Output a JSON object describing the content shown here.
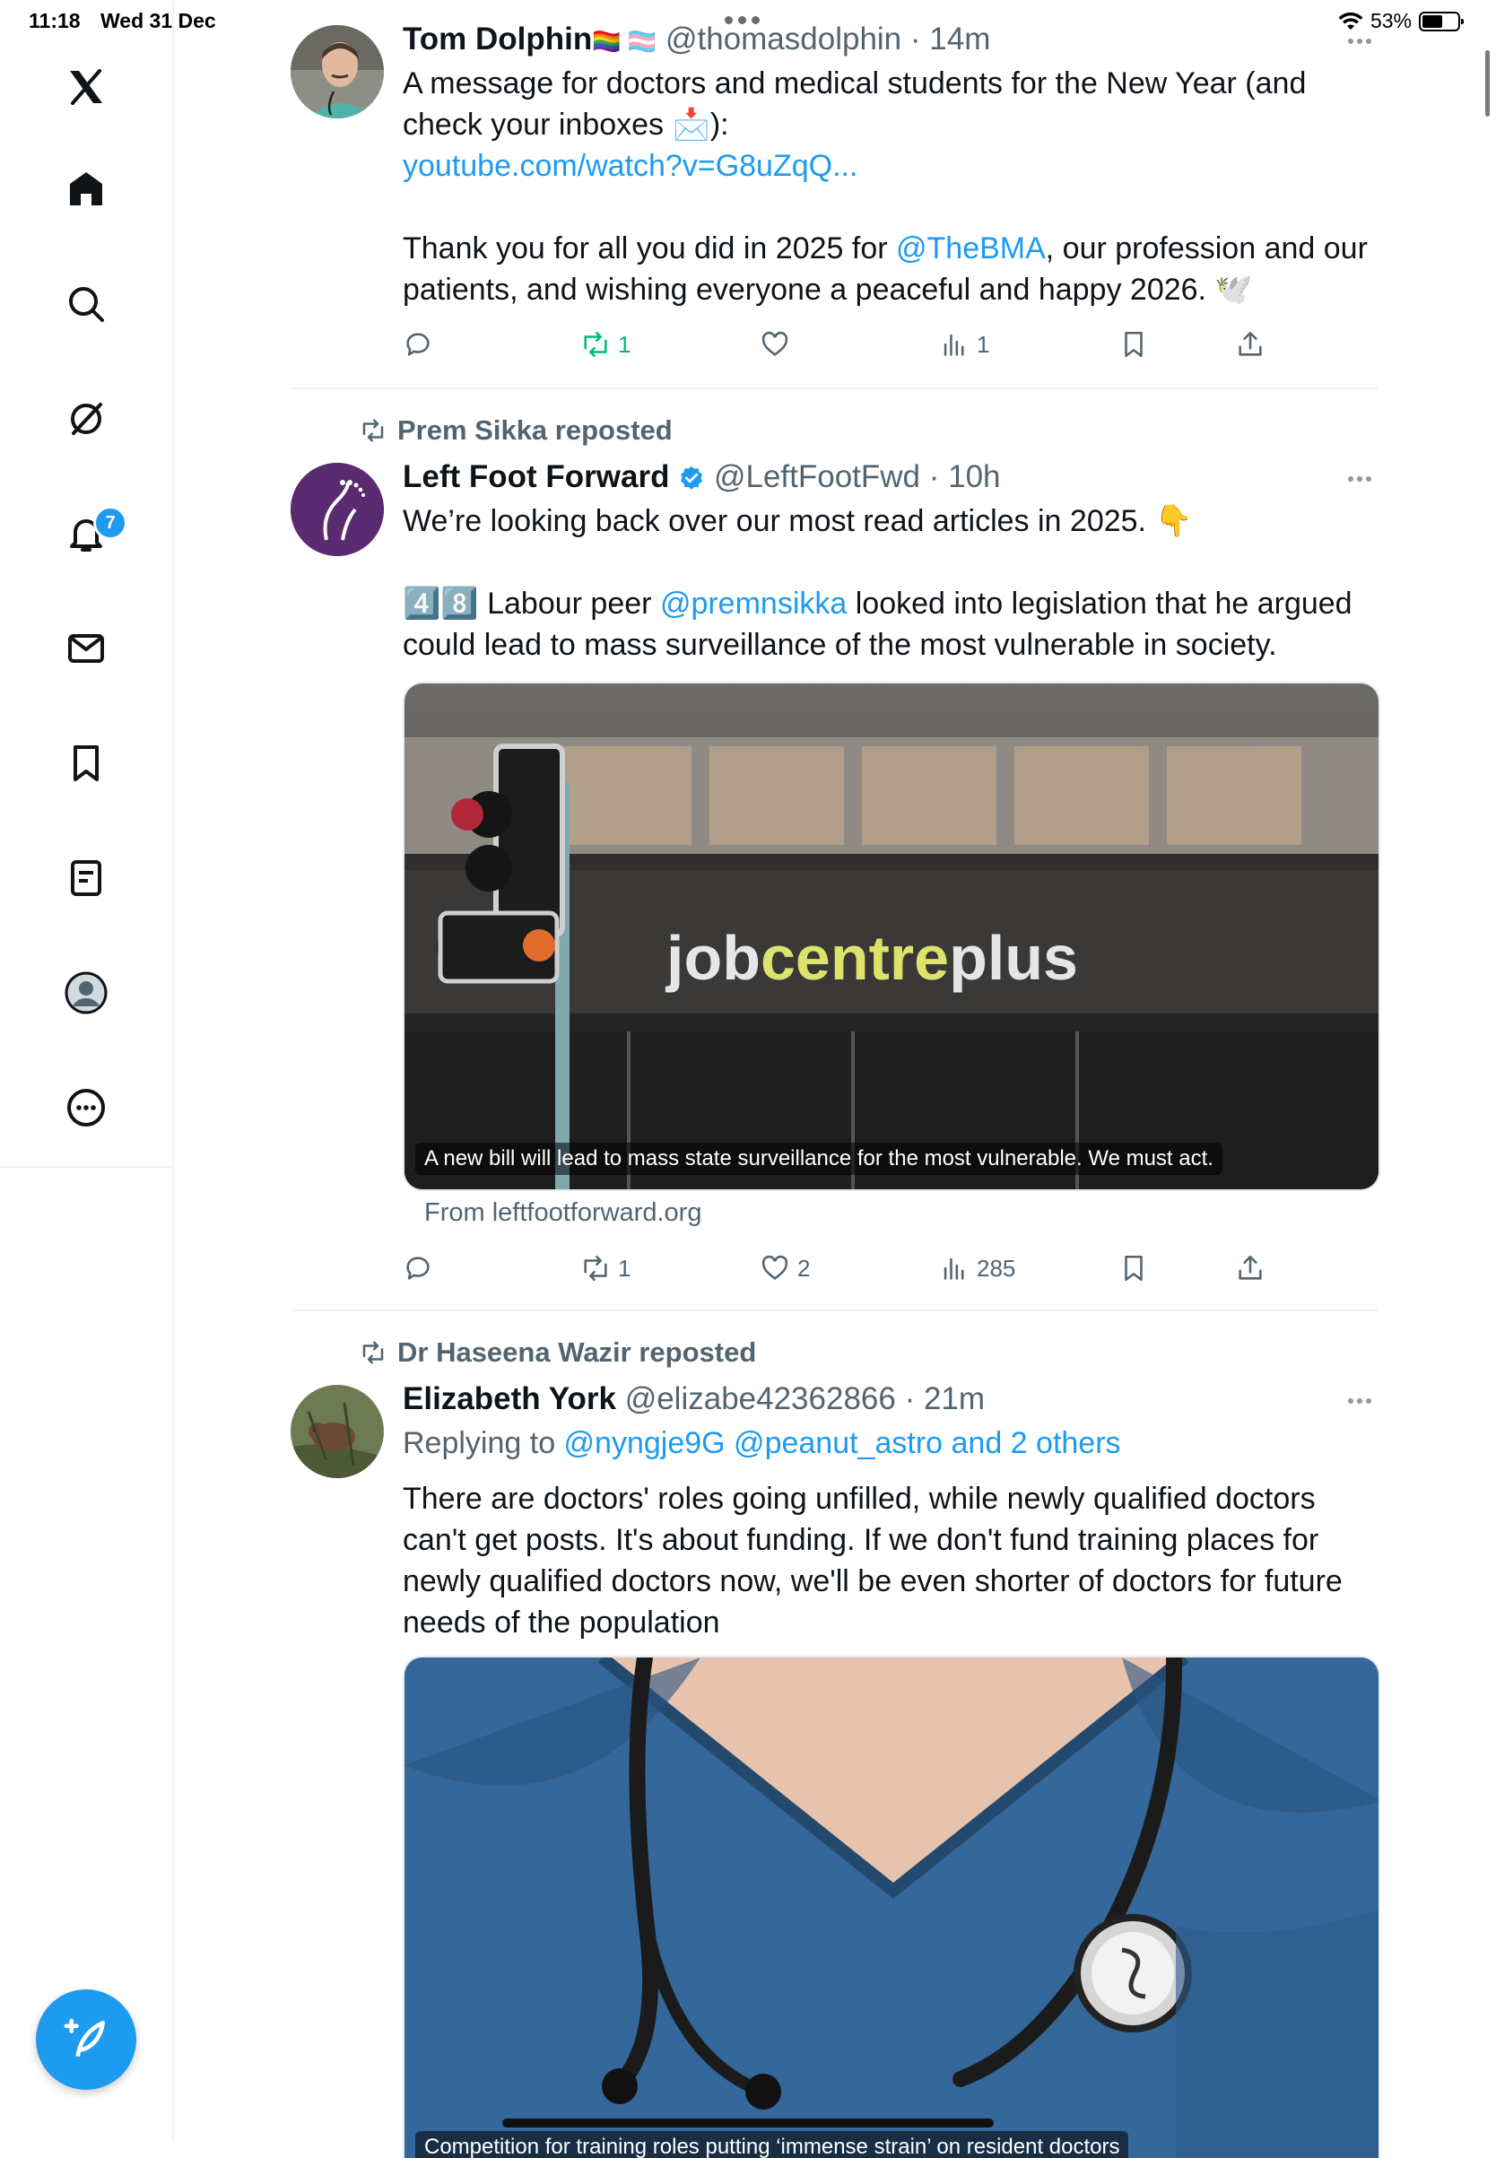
{
  "status_bar": {
    "time": "11:18",
    "date": "Wed 31 Dec",
    "battery": "53%"
  },
  "sidebar": {
    "items": [
      "x-logo",
      "home",
      "search",
      "grok",
      "notifications",
      "messages",
      "bookmarks",
      "lists",
      "profile",
      "more"
    ],
    "notification_badge": "7"
  },
  "posts": [
    {
      "name": "Tom Dolphin",
      "name_emoji": "🏳️‍🌈 🏳️‍⚧️",
      "handle": "@thomasdolphin",
      "time": "14m",
      "text1": "A message for doctors and medical students for the New Year (and check your inboxes 📩):",
      "link": "youtube.com/watch?v=G8uZqQ...",
      "text2_pre": "Thank you for all you did in 2025 for ",
      "mention": "@TheBMA",
      "text2_post": ", our profession and our patients, and wishing everyone a peaceful and happy 2026. 🕊️",
      "replies": "",
      "reposts": "1",
      "likes": "",
      "views": "1"
    },
    {
      "reposted_by": "Prem Sikka reposted",
      "name": "Left Foot Forward",
      "handle": "@LeftFootFwd",
      "time": "10h",
      "text1": "We’re looking back over our most read articles in 2025. 👇",
      "text2_pre": "4️⃣8️⃣ Labour peer ",
      "mention": "@premnsikka",
      "text2_post": " looked into legislation that he argued could lead to mass surveillance of the most vulnerable in society.",
      "card_sign": "jobcentreplus",
      "card_sign_a": "job",
      "card_sign_b": "centre",
      "card_sign_c": "plus",
      "card_caption": "A new bill will lead to mass state surveillance for the most vulnerable. We must act.",
      "card_from": "From leftfootforward.org",
      "replies": "",
      "reposts": "1",
      "likes": "2",
      "views": "285"
    },
    {
      "reposted_by": "Dr Haseena Wazir reposted",
      "name": "Elizabeth York",
      "handle": "@elizabe42362866",
      "time": "21m",
      "replying_prefix": "Replying to ",
      "replying_to": "@nyngje9G @peanut_astro and 2 others",
      "text1": "There are doctors' roles going unfilled, while newly qualified doctors can't get posts.  It's about funding.  If we don't fund training places for newly qualified doctors now, we'll be even shorter of doctors for future needs of the population",
      "card_caption": "Competition for training roles putting ‘immense strain’ on resident doctors"
    }
  ],
  "colors": {
    "accent": "#1d9bf0",
    "repost_active": "#00ba7c",
    "muted": "#536471"
  }
}
